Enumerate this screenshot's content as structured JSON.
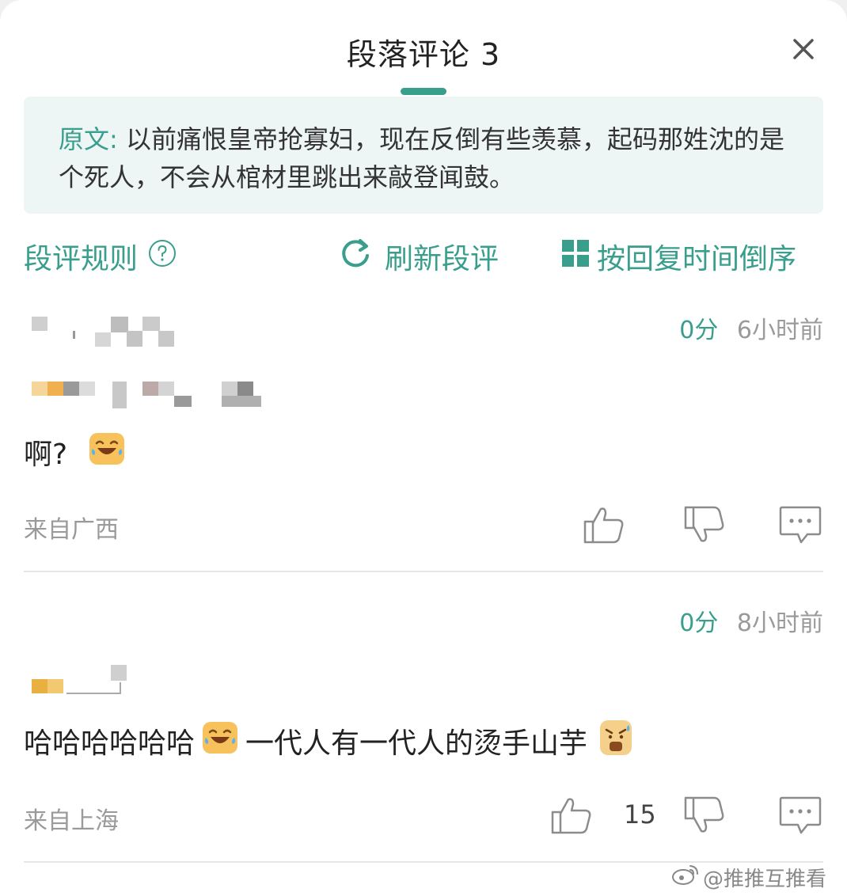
{
  "header": {
    "title": "段落评论 3"
  },
  "quote": {
    "label": "原文:",
    "text": "以前痛恨皇帝抢寡妇，现在反倒有些羡慕，起码那姓沈的是个死人，不会从棺材里跳出来敲登闻鼓。"
  },
  "toolbar": {
    "rules_label": "段评规则",
    "refresh_label": "刷新段评",
    "sort_label": "按回复时间倒序"
  },
  "comments": [
    {
      "score": "0分",
      "time": "6小时前",
      "text": "啊?",
      "location": "来自广西",
      "like_count": ""
    },
    {
      "score": "0分",
      "time": "8小时前",
      "text_a": "哈哈哈哈哈哈",
      "text_b": "一代人有一代人的烫手山芋",
      "location": "来自上海",
      "like_count": "15"
    }
  ],
  "watermark": {
    "text": "@推推互推看"
  },
  "colors": {
    "accent": "#3a9e8d",
    "quote_bg": "#eef6f5",
    "muted": "#9a9a9a"
  }
}
